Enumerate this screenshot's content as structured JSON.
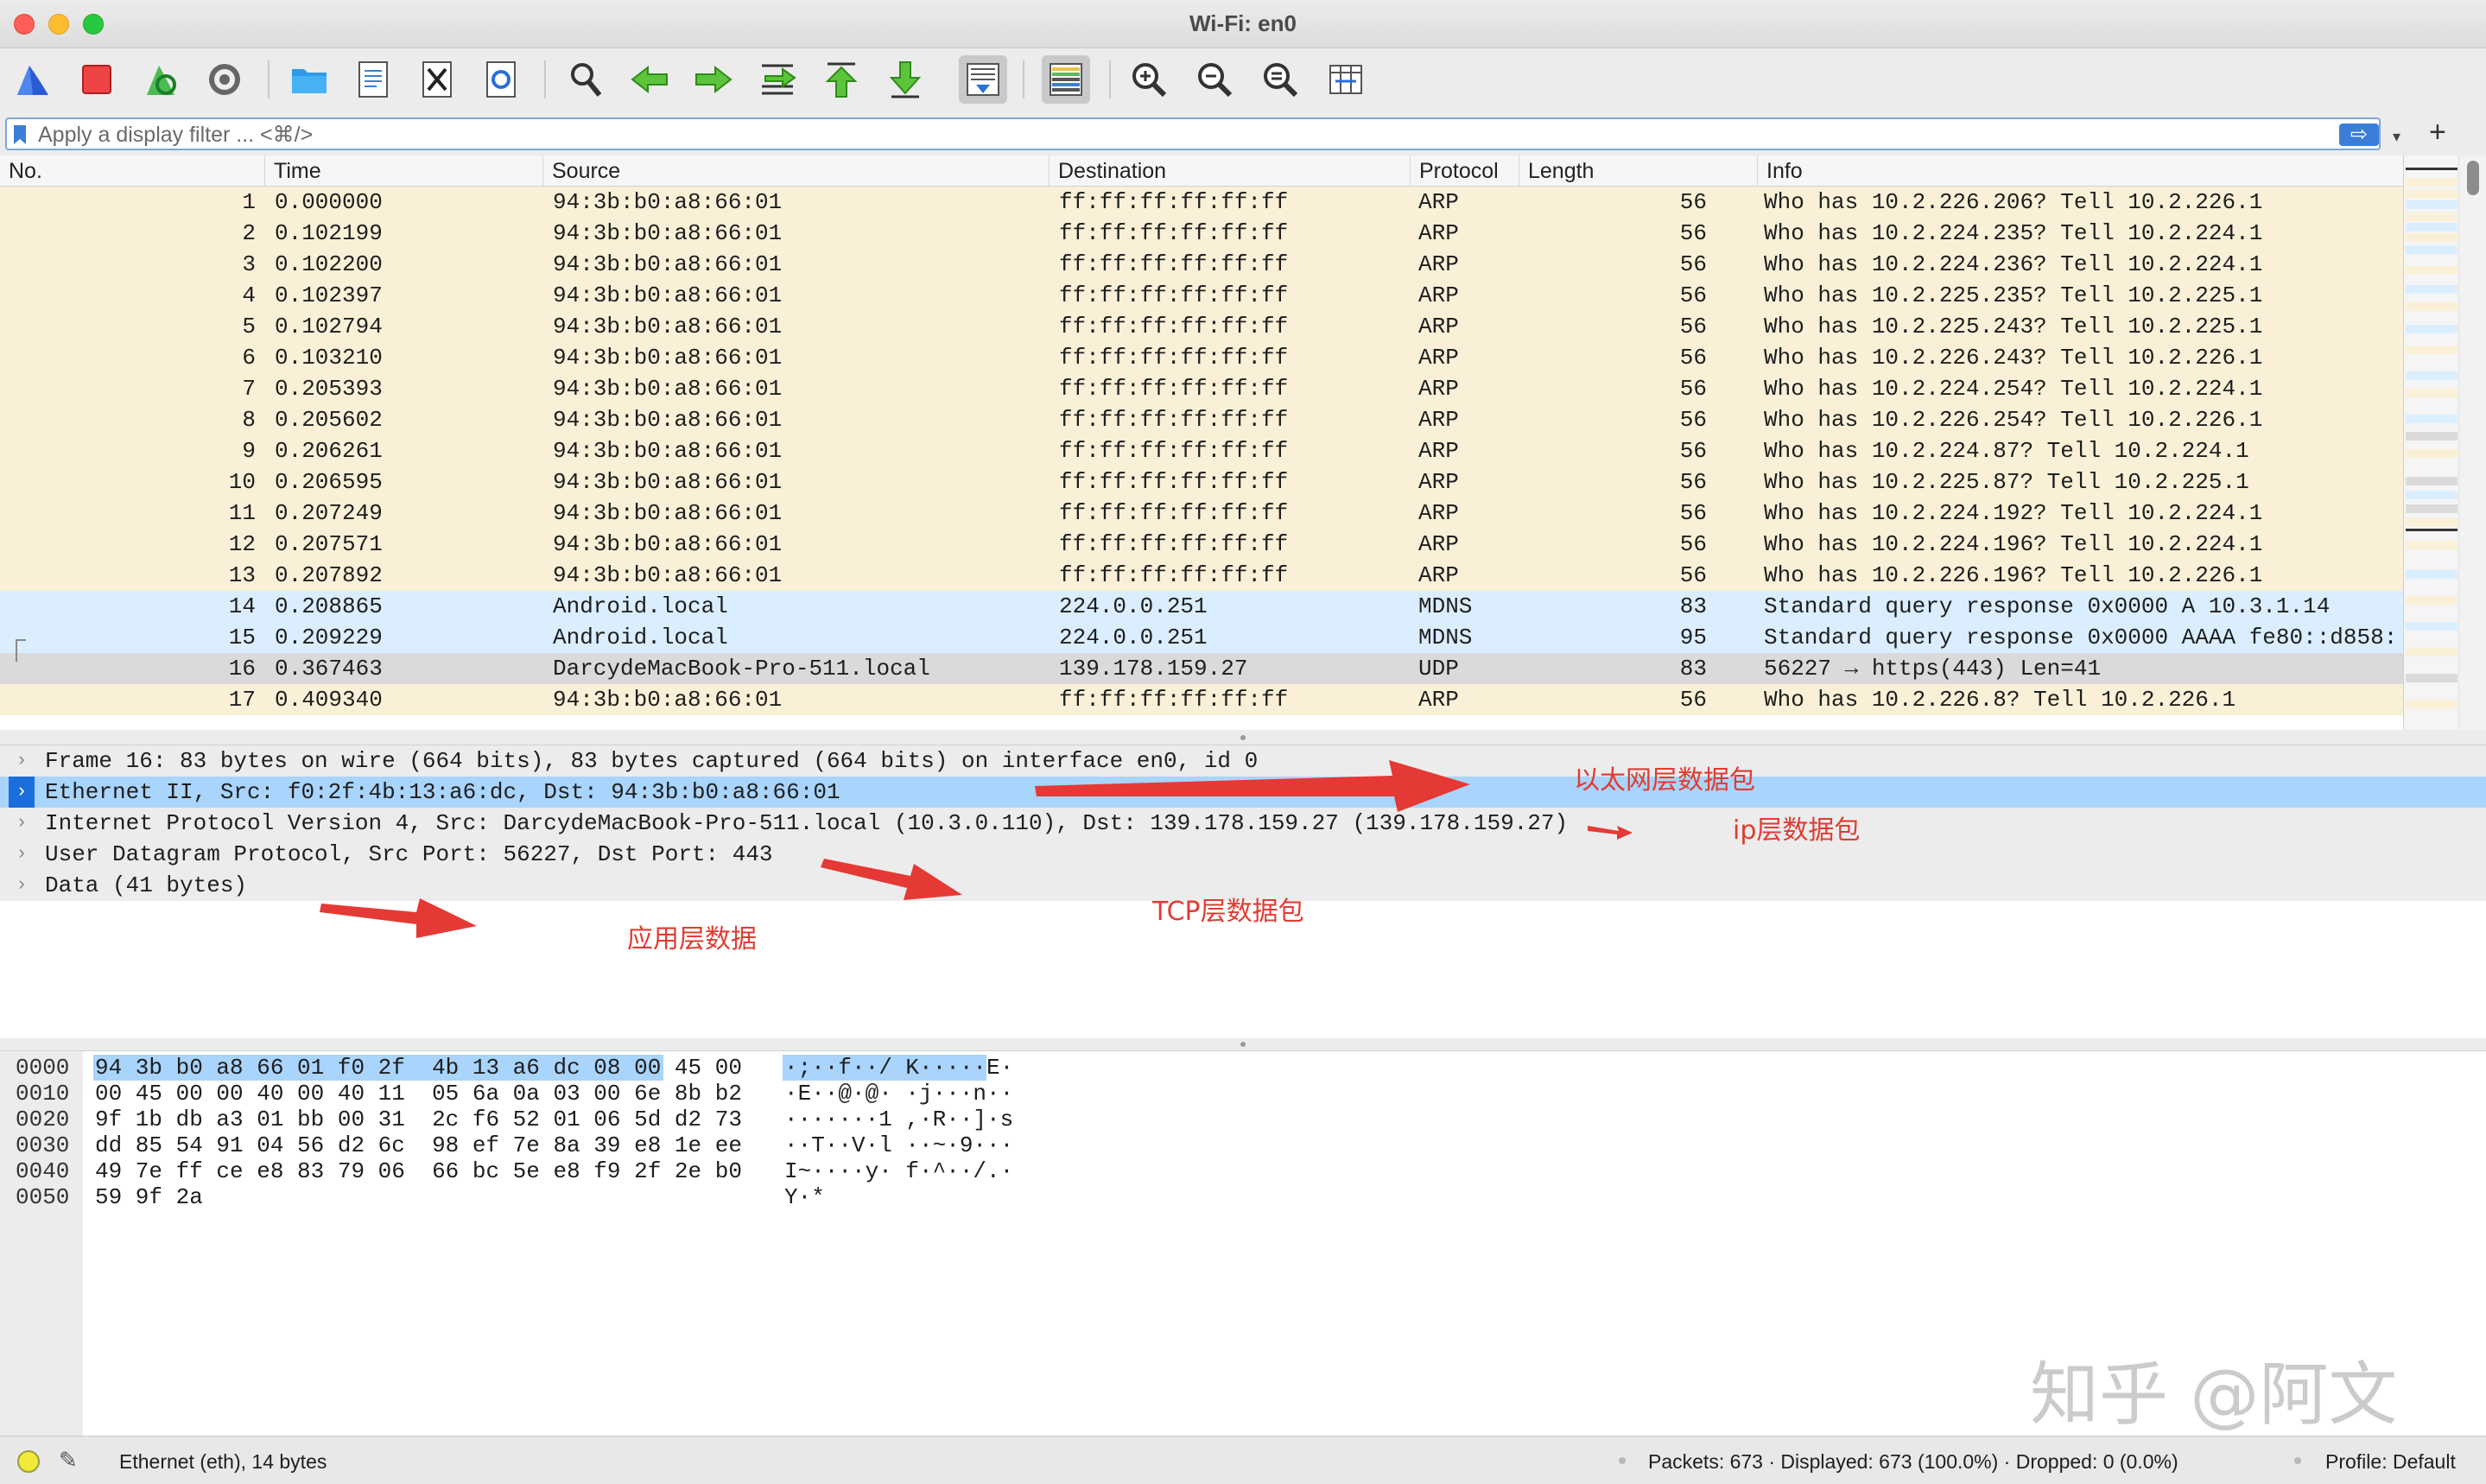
{
  "window": {
    "title": "Wi-Fi: en0"
  },
  "toolbar": {
    "items": [
      "shark-fin-start-icon",
      "stop-capture-icon",
      "restart-capture-icon",
      "capture-options-icon",
      "open-file-icon",
      "save-file-icon",
      "close-file-icon",
      "reload-file-icon",
      "find-packet-icon",
      "go-back-icon",
      "go-forward-icon",
      "go-to-packet-icon",
      "first-packet-icon",
      "last-packet-icon",
      "autoscroll-icon",
      "colorize-icon",
      "zoom-in-icon",
      "zoom-out-icon",
      "normal-size-icon",
      "resize-columns-icon"
    ]
  },
  "filter": {
    "placeholder": "Apply a display filter ... <⌘/>",
    "apply": "⇨",
    "add": "+"
  },
  "columns": {
    "no": "No.",
    "time": "Time",
    "source": "Source",
    "destination": "Destination",
    "protocol": "Protocol",
    "length": "Length",
    "info": "Info"
  },
  "packets": [
    {
      "no": "1",
      "time": "0.000000",
      "src": "94:3b:b0:a8:66:01",
      "dst": "ff:ff:ff:ff:ff:ff",
      "proto": "ARP",
      "len": "56",
      "info": "Who has 10.2.226.206? Tell 10.2.226.1"
    },
    {
      "no": "2",
      "time": "0.102199",
      "src": "94:3b:b0:a8:66:01",
      "dst": "ff:ff:ff:ff:ff:ff",
      "proto": "ARP",
      "len": "56",
      "info": "Who has 10.2.224.235? Tell 10.2.224.1"
    },
    {
      "no": "3",
      "time": "0.102200",
      "src": "94:3b:b0:a8:66:01",
      "dst": "ff:ff:ff:ff:ff:ff",
      "proto": "ARP",
      "len": "56",
      "info": "Who has 10.2.224.236? Tell 10.2.224.1"
    },
    {
      "no": "4",
      "time": "0.102397",
      "src": "94:3b:b0:a8:66:01",
      "dst": "ff:ff:ff:ff:ff:ff",
      "proto": "ARP",
      "len": "56",
      "info": "Who has 10.2.225.235? Tell 10.2.225.1"
    },
    {
      "no": "5",
      "time": "0.102794",
      "src": "94:3b:b0:a8:66:01",
      "dst": "ff:ff:ff:ff:ff:ff",
      "proto": "ARP",
      "len": "56",
      "info": "Who has 10.2.225.243? Tell 10.2.225.1"
    },
    {
      "no": "6",
      "time": "0.103210",
      "src": "94:3b:b0:a8:66:01",
      "dst": "ff:ff:ff:ff:ff:ff",
      "proto": "ARP",
      "len": "56",
      "info": "Who has 10.2.226.243? Tell 10.2.226.1"
    },
    {
      "no": "7",
      "time": "0.205393",
      "src": "94:3b:b0:a8:66:01",
      "dst": "ff:ff:ff:ff:ff:ff",
      "proto": "ARP",
      "len": "56",
      "info": "Who has 10.2.224.254? Tell 10.2.224.1"
    },
    {
      "no": "8",
      "time": "0.205602",
      "src": "94:3b:b0:a8:66:01",
      "dst": "ff:ff:ff:ff:ff:ff",
      "proto": "ARP",
      "len": "56",
      "info": "Who has 10.2.226.254? Tell 10.2.226.1"
    },
    {
      "no": "9",
      "time": "0.206261",
      "src": "94:3b:b0:a8:66:01",
      "dst": "ff:ff:ff:ff:ff:ff",
      "proto": "ARP",
      "len": "56",
      "info": "Who has 10.2.224.87? Tell 10.2.224.1"
    },
    {
      "no": "10",
      "time": "0.206595",
      "src": "94:3b:b0:a8:66:01",
      "dst": "ff:ff:ff:ff:ff:ff",
      "proto": "ARP",
      "len": "56",
      "info": "Who has 10.2.225.87? Tell 10.2.225.1"
    },
    {
      "no": "11",
      "time": "0.207249",
      "src": "94:3b:b0:a8:66:01",
      "dst": "ff:ff:ff:ff:ff:ff",
      "proto": "ARP",
      "len": "56",
      "info": "Who has 10.2.224.192? Tell 10.2.224.1"
    },
    {
      "no": "12",
      "time": "0.207571",
      "src": "94:3b:b0:a8:66:01",
      "dst": "ff:ff:ff:ff:ff:ff",
      "proto": "ARP",
      "len": "56",
      "info": "Who has 10.2.224.196? Tell 10.2.224.1"
    },
    {
      "no": "13",
      "time": "0.207892",
      "src": "94:3b:b0:a8:66:01",
      "dst": "ff:ff:ff:ff:ff:ff",
      "proto": "ARP",
      "len": "56",
      "info": "Who has 10.2.226.196? Tell 10.2.226.1"
    },
    {
      "no": "14",
      "time": "0.208865",
      "src": "Android.local",
      "dst": "224.0.0.251",
      "proto": "MDNS",
      "len": "83",
      "info": "Standard query response 0x0000 A 10.3.1.14"
    },
    {
      "no": "15",
      "time": "0.209229",
      "src": "Android.local",
      "dst": "224.0.0.251",
      "proto": "MDNS",
      "len": "95",
      "info": "Standard query response 0x0000 AAAA fe80::d858:"
    },
    {
      "no": "16",
      "time": "0.367463",
      "src": "DarcydeMacBook-Pro-511.local",
      "dst": "139.178.159.27",
      "proto": "UDP",
      "len": "83",
      "info": "56227 → https(443) Len=41"
    },
    {
      "no": "17",
      "time": "0.409340",
      "src": "94:3b:b0:a8:66:01",
      "dst": "ff:ff:ff:ff:ff:ff",
      "proto": "ARP",
      "len": "56",
      "info": "Who has 10.2.226.8? Tell 10.2.226.1"
    }
  ],
  "row_colors": {
    "ARP": "#faf0d7",
    "MDNS": "#daeeff",
    "UDP": "#dadada"
  },
  "details": [
    "Frame 16: 83 bytes on wire (664 bits), 83 bytes captured (664 bits) on interface en0, id 0",
    "Ethernet II, Src: f0:2f:4b:13:a6:dc, Dst: 94:3b:b0:a8:66:01",
    "Internet Protocol Version 4, Src: DarcydeMacBook-Pro-511.local (10.3.0.110), Dst: 139.178.159.27 (139.178.159.27)",
    "User Datagram Protocol, Src Port: 56227, Dst Port: 443",
    "Data (41 bytes)"
  ],
  "bytes": [
    {
      "off": "0000",
      "hex": "94 3b b0 a8 66 01 f0 2f  4b 13 a6 dc 08 00 45 00",
      "ascii": "·;··f··/ K·····E·"
    },
    {
      "off": "0010",
      "hex": "00 45 00 00 40 00 40 11  05 6a 0a 03 00 6e 8b b2",
      "ascii": "·E··@·@· ·j···n··"
    },
    {
      "off": "0020",
      "hex": "9f 1b db a3 01 bb 00 31  2c f6 52 01 06 5d d2 73",
      "ascii": "·······1 ,·R··]·s"
    },
    {
      "off": "0030",
      "hex": "dd 85 54 91 04 56 d2 6c  98 ef 7e 8a 39 e8 1e ee",
      "ascii": "··T··V·l ··~·9···"
    },
    {
      "off": "0040",
      "hex": "49 7e ff ce e8 83 79 06  66 bc 5e e8 f9 2f 2e b0",
      "ascii": "I~····y· f·^··/.·"
    },
    {
      "off": "0050",
      "hex": "59 9f 2a",
      "ascii": "Y·*"
    }
  ],
  "annotations": {
    "ethernet": "以太网层数据包",
    "ip": "ip层数据包",
    "tcp": "TCP层数据包",
    "app": "应用层数据"
  },
  "watermark": "知乎 @阿文",
  "status": {
    "field": "Ethernet (eth), 14 bytes",
    "counts": "Packets: 673 · Displayed: 673 (100.0%) · Dropped: 0 (0.0%)",
    "profile": "Profile: Default"
  }
}
